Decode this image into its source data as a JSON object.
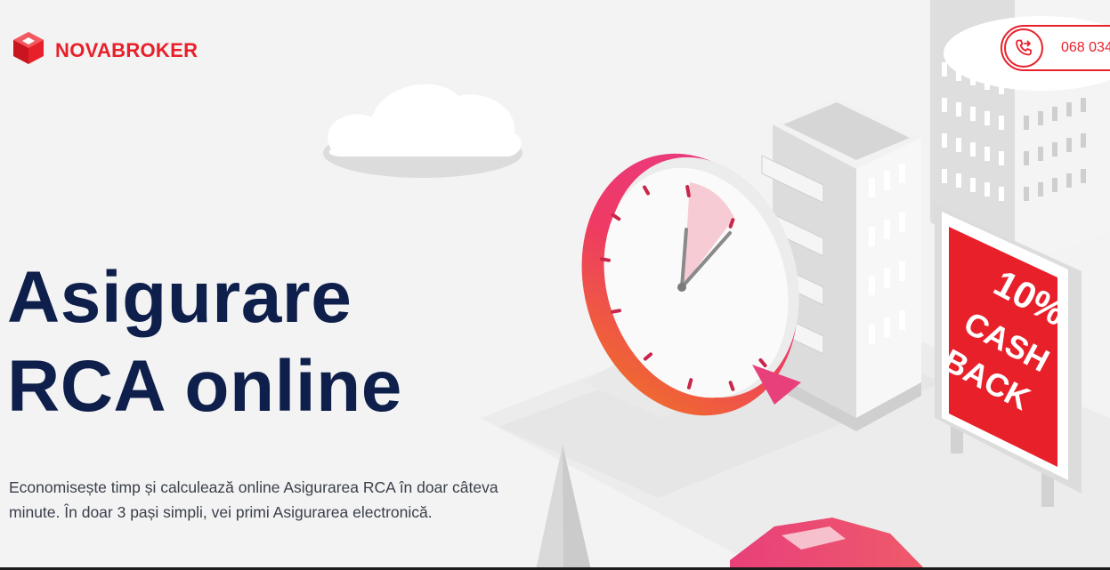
{
  "brand": {
    "name": "NOVABROKER",
    "color": "#e8202a",
    "logo_icon": "cube-logo-icon"
  },
  "contact": {
    "phone_partial": "068 034",
    "icon": "phone-forward-icon"
  },
  "hero": {
    "title_line1": "Asigurare",
    "title_line2": "RCA online",
    "description": "Economisește timp și calculează online Asigurarea RCA în doar câteva minute. În doar 3 pași simpli, vei primi Asigurarea electronică."
  },
  "illustration": {
    "billboard_line1": "10%",
    "billboard_line2": "CASH",
    "billboard_line3": "BACK",
    "accent_red": "#e8202a",
    "title_color": "#0f1f4b"
  }
}
